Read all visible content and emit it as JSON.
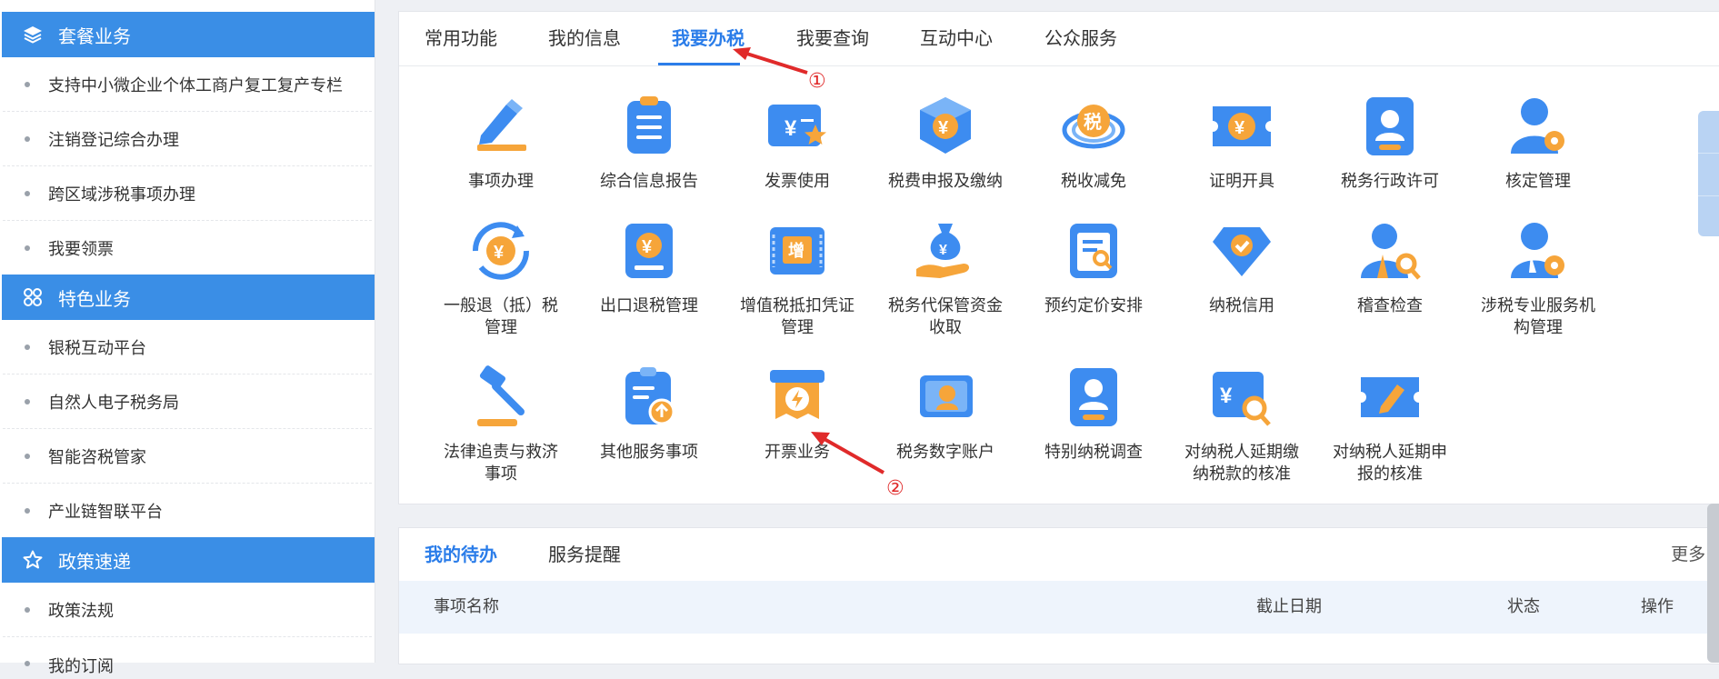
{
  "sidebar": {
    "sections": [
      {
        "icon": "layers-icon",
        "title": "套餐业务",
        "items": [
          "支持中小微企业个体工商户复工复产专栏",
          "注销登记综合办理",
          "跨区域涉税事项办理",
          "我要领票"
        ]
      },
      {
        "icon": "grid-apps-icon",
        "title": "特色业务",
        "items": [
          "银税互动平台",
          "自然人电子税务局",
          "智能咨税管家",
          "产业链智联平台"
        ]
      },
      {
        "icon": "star-icon",
        "title": "政策速递",
        "items": [
          "政策法规",
          "我的订阅"
        ]
      }
    ]
  },
  "tabs": [
    {
      "label": "常用功能",
      "active": false
    },
    {
      "label": "我的信息",
      "active": false
    },
    {
      "label": "我要办税",
      "active": true
    },
    {
      "label": "我要查询",
      "active": false
    },
    {
      "label": "互动中心",
      "active": false
    },
    {
      "label": "公众服务",
      "active": false
    }
  ],
  "services": [
    {
      "label": "事项办理",
      "icon": "pencil-icon"
    },
    {
      "label": "综合信息报告",
      "icon": "clipboard-list-icon"
    },
    {
      "label": "发票使用",
      "icon": "invoice-star-icon"
    },
    {
      "label": "税费申报及缴纳",
      "icon": "yuan-box-icon"
    },
    {
      "label": "税收减免",
      "icon": "tax-seal-icon"
    },
    {
      "label": "证明开具",
      "icon": "yuan-ticket-icon"
    },
    {
      "label": "税务行政许可",
      "icon": "id-badge-icon"
    },
    {
      "label": "核定管理",
      "icon": "user-gear-icon"
    },
    {
      "label": "一般退（抵）税管理",
      "icon": "yuan-refresh-icon"
    },
    {
      "label": "出口退税管理",
      "icon": "yuan-document-icon"
    },
    {
      "label": "增值税抵扣凭证管理",
      "icon": "vat-ticket-icon"
    },
    {
      "label": "税务代保管资金收取",
      "icon": "money-bag-hand-icon"
    },
    {
      "label": "预约定价安排",
      "icon": "document-search-icon"
    },
    {
      "label": "纳税信用",
      "icon": "diamond-check-icon"
    },
    {
      "label": "稽查检查",
      "icon": "user-search-icon"
    },
    {
      "label": "涉税专业服务机构管理",
      "icon": "user-settings-icon"
    },
    {
      "label": "法律追责与救济事项",
      "icon": "gavel-icon"
    },
    {
      "label": "其他服务事项",
      "icon": "clipboard-upload-icon"
    },
    {
      "label": "开票业务",
      "icon": "invoice-lightning-icon"
    },
    {
      "label": "税务数字账户",
      "icon": "account-card-icon"
    },
    {
      "label": "特别纳税调查",
      "icon": "person-card-icon"
    },
    {
      "label": "对纳税人延期缴纳税款的核准",
      "icon": "yuan-search-icon"
    },
    {
      "label": "对纳税人延期申报的核准",
      "icon": "ticket-edit-icon"
    }
  ],
  "todo": {
    "tabs": [
      {
        "label": "我的待办",
        "active": true
      },
      {
        "label": "服务提醒",
        "active": false
      }
    ],
    "more": "更多>",
    "columns": [
      "事项名称",
      "截止日期",
      "状态",
      "操作"
    ]
  },
  "annotations": [
    "①",
    "②"
  ],
  "colors": {
    "accent": "#2b7de9",
    "sidebar_header": "#3a8ee6",
    "annotation": "#e02a2a",
    "icon_blue": "#3d8cf0",
    "icon_orange": "#f6a53a"
  }
}
